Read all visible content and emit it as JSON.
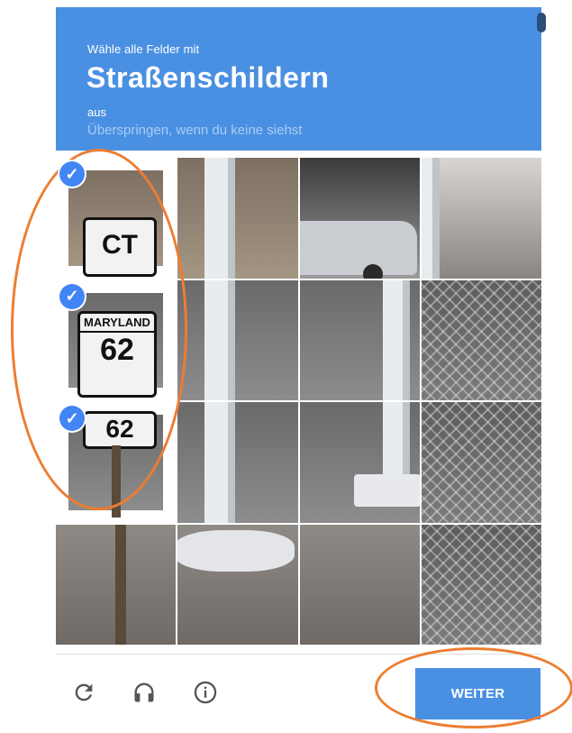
{
  "header": {
    "line1": "Wähle alle Felder mit",
    "keyword": "Straßenschildern",
    "line3": "aus",
    "line4": "Überspringen, wenn du keine siehst"
  },
  "tiles": [
    {
      "row": 1,
      "col": 1,
      "selected": true
    },
    {
      "row": 1,
      "col": 2,
      "selected": false
    },
    {
      "row": 1,
      "col": 3,
      "selected": false
    },
    {
      "row": 1,
      "col": 4,
      "selected": false
    },
    {
      "row": 2,
      "col": 1,
      "selected": true
    },
    {
      "row": 2,
      "col": 2,
      "selected": false
    },
    {
      "row": 2,
      "col": 3,
      "selected": false
    },
    {
      "row": 2,
      "col": 4,
      "selected": false
    },
    {
      "row": 3,
      "col": 1,
      "selected": true
    },
    {
      "row": 3,
      "col": 2,
      "selected": false
    },
    {
      "row": 3,
      "col": 3,
      "selected": false
    },
    {
      "row": 3,
      "col": 4,
      "selected": false
    },
    {
      "row": 4,
      "col": 1,
      "selected": false
    },
    {
      "row": 4,
      "col": 2,
      "selected": false
    },
    {
      "row": 4,
      "col": 3,
      "selected": false
    },
    {
      "row": 4,
      "col": 4,
      "selected": false
    }
  ],
  "sign": {
    "top_text": "CT",
    "state": "MARYLAND",
    "number": "62",
    "number_bottom": "62"
  },
  "check_mark": "✓",
  "footer": {
    "icons": [
      "reload-icon",
      "headphones-icon",
      "info-icon"
    ],
    "submit_label": "WEITER"
  },
  "colors": {
    "header_bg": "#4a90e2",
    "button_bg": "#4a90e2",
    "check_bg": "#4285f4",
    "annotation": "#ed7d31"
  }
}
